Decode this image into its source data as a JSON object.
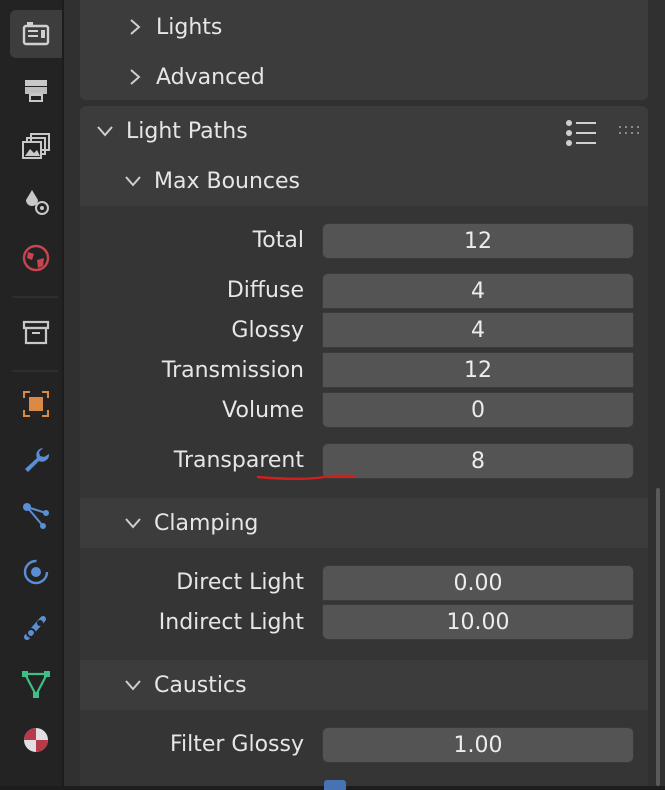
{
  "tabs": [
    {
      "id": "render",
      "icon": "render-camera-icon",
      "active": true
    },
    {
      "id": "output",
      "icon": "output-printer-icon"
    },
    {
      "id": "view-layer",
      "icon": "view-layer-icon"
    },
    {
      "id": "scene",
      "icon": "scene-icon"
    },
    {
      "id": "world",
      "icon": "world-icon"
    },
    {
      "id": "collection",
      "icon": "collection-icon"
    },
    {
      "id": "object",
      "icon": "object-icon"
    },
    {
      "id": "modifiers",
      "icon": "wrench-icon"
    },
    {
      "id": "particles",
      "icon": "particles-icon"
    },
    {
      "id": "physics",
      "icon": "physics-icon"
    },
    {
      "id": "constraints",
      "icon": "constraints-icon"
    },
    {
      "id": "data",
      "icon": "mesh-data-icon"
    },
    {
      "id": "material",
      "icon": "material-icon"
    }
  ],
  "sections": {
    "lights": "Lights",
    "advanced": "Advanced",
    "light_paths": "Light Paths",
    "max_bounces": "Max Bounces",
    "clamping": "Clamping",
    "caustics": "Caustics"
  },
  "max_bounces": {
    "total": {
      "label": "Total",
      "value": "12"
    },
    "diffuse": {
      "label": "Diffuse",
      "value": "4"
    },
    "glossy": {
      "label": "Glossy",
      "value": "4"
    },
    "transmission": {
      "label": "Transmission",
      "value": "12"
    },
    "volume": {
      "label": "Volume",
      "value": "0"
    },
    "transparent": {
      "label": "Transparent",
      "value": "8"
    }
  },
  "clamping": {
    "direct": {
      "label": "Direct Light",
      "value": "0.00"
    },
    "indirect": {
      "label": "Indirect Light",
      "value": "10.00"
    }
  },
  "caustics": {
    "filter_glossy": {
      "label": "Filter Glossy",
      "value": "1.00"
    }
  },
  "colors": {
    "annotation": "#d0201e",
    "accent": "#4772b3"
  }
}
